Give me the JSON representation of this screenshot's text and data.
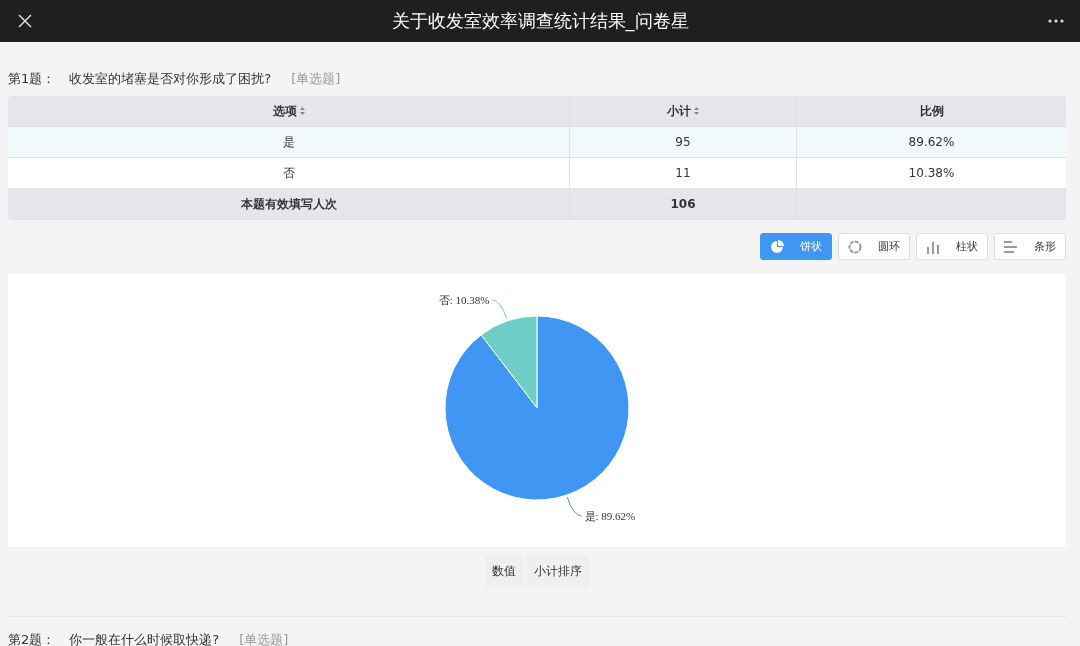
{
  "window": {
    "title": "关于收发室效率调查统计结果_问卷星"
  },
  "question": {
    "number": "第1题：",
    "text": "收发室的堵塞是否对你形成了困扰?",
    "type": "[单选题]"
  },
  "table": {
    "columns": [
      {
        "label": "选项",
        "sortable": true
      },
      {
        "label": "小计",
        "sortable": true
      },
      {
        "label": "比例",
        "sortable": false
      }
    ],
    "rows": [
      [
        "是",
        "95",
        "89.62%"
      ],
      [
        "否",
        "11",
        "10.38%"
      ]
    ],
    "footer": [
      "本题有效填写人次",
      "106"
    ]
  },
  "chart_types": [
    {
      "kind": "pie",
      "label": "饼状",
      "selected": true
    },
    {
      "kind": "donut",
      "label": "圆环",
      "selected": false
    },
    {
      "kind": "bar",
      "label": "柱状",
      "selected": false
    },
    {
      "kind": "hbar",
      "label": "条形",
      "selected": false
    }
  ],
  "chart": {
    "chart_data": {
      "type": "pie",
      "categories": [
        "是",
        "否"
      ],
      "values": [
        89.62,
        10.38
      ],
      "value_labels": [
        "89.62%",
        "10.38%"
      ],
      "colors": [
        "#4096f3",
        "#6fcdc8"
      ]
    }
  },
  "chart_actions": [
    "数值",
    "小计排序"
  ],
  "next_question": {
    "number": "第2题：",
    "text": "你一般在什么时候取快递?",
    "type": "[单选题]"
  }
}
